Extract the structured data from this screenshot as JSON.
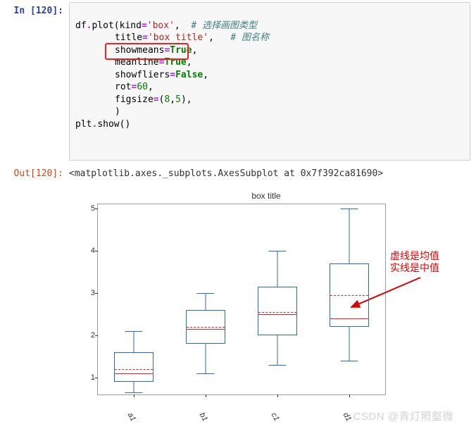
{
  "cells": {
    "in_label": "In [120]:",
    "out_label": "Out[120]:",
    "code": {
      "l1_a": "df",
      "l1_b": ".",
      "l1_c": "plot(kind",
      "l1_d": "=",
      "l1_e": "'box'",
      "l1_f": ",  ",
      "l1_g": "# 选择画图类型",
      "l2_a": "title",
      "l2_b": "=",
      "l2_c": "'box title'",
      "l2_d": ",   ",
      "l2_e": "# 图名称",
      "l3_a": "showmeans",
      "l3_b": "=",
      "l3_c": "True",
      "l3_d": ",",
      "l4_a": "meanline",
      "l4_b": "=",
      "l4_c": "True",
      "l4_d": ",",
      "l5_a": "showfliers",
      "l5_b": "=",
      "l5_c": "False",
      "l5_d": ",",
      "l6_a": "rot",
      "l6_b": "=",
      "l6_c": "60",
      "l6_d": ",",
      "l7_a": "figsize",
      "l7_b": "=",
      "l7_c": "(",
      "l7_d": "8",
      "l7_e": ",",
      "l7_f": "5",
      "l7_g": "),",
      "l8_a": ")",
      "l9_a": "plt",
      "l9_b": ".",
      "l9_c": "show()"
    },
    "output_text": "<matplotlib.axes._subplots.AxesSubplot at 0x7f392ca81690>"
  },
  "annotation": {
    "line1": "虚线是均值",
    "line2": "实线是中值"
  },
  "watermark": "CSDN @青灯照壑微",
  "chart_data": {
    "type": "box",
    "title": "box title",
    "xlabel": "",
    "ylabel": "",
    "ylim": [
      0.6,
      5.1
    ],
    "yticks": [
      1,
      2,
      3,
      4,
      5
    ],
    "categories": [
      "a1",
      "b1",
      "c1",
      "d1"
    ],
    "rot": 60,
    "series": [
      {
        "name": "a1",
        "whisker_low": 0.65,
        "q1": 0.9,
        "median": 1.1,
        "mean": 1.2,
        "q3": 1.6,
        "whisker_high": 2.1
      },
      {
        "name": "b1",
        "whisker_low": 1.1,
        "q1": 1.8,
        "median": 2.15,
        "mean": 2.2,
        "q3": 2.6,
        "whisker_high": 3.0
      },
      {
        "name": "c1",
        "whisker_low": 1.3,
        "q1": 2.0,
        "median": 2.5,
        "mean": 2.55,
        "q3": 3.15,
        "whisker_high": 4.0
      },
      {
        "name": "d1",
        "whisker_low": 1.4,
        "q1": 2.2,
        "median": 2.4,
        "mean": 2.95,
        "q3": 3.7,
        "whisker_high": 5.0
      }
    ],
    "showmeans": true,
    "meanline": true,
    "showfliers": false
  }
}
